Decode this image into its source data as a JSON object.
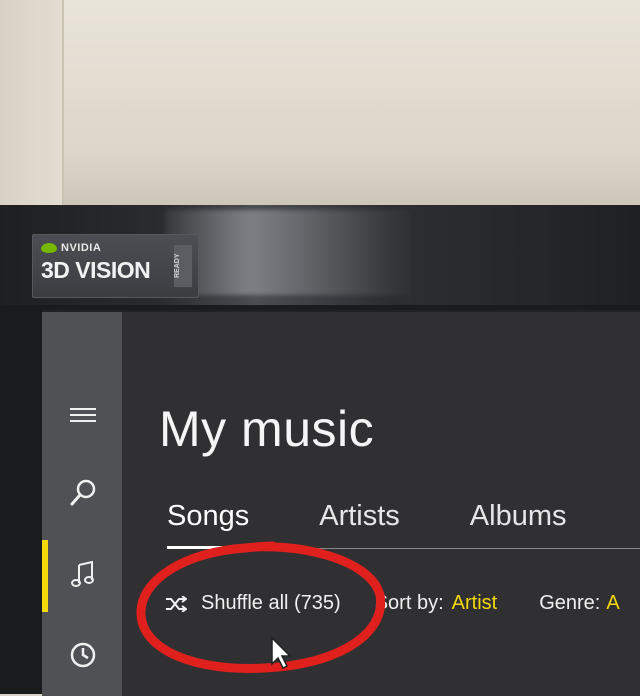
{
  "sticker": {
    "brand": "NVIDIA",
    "product": "3D VISION",
    "tag": "READY"
  },
  "sidebar": {
    "items": [
      {
        "name": "menu",
        "icon": "hamburger-icon"
      },
      {
        "name": "search",
        "icon": "search-icon"
      },
      {
        "name": "music",
        "icon": "music-note-icon",
        "active": true
      },
      {
        "name": "recent",
        "icon": "clock-icon"
      }
    ]
  },
  "main": {
    "title": "My music",
    "tabs": [
      {
        "label": "Songs",
        "active": true
      },
      {
        "label": "Artists",
        "active": false
      },
      {
        "label": "Albums",
        "active": false
      }
    ],
    "toolbar": {
      "shuffle_label": "Shuffle all (735)",
      "sort_label": "Sort by:",
      "sort_value": "Artist",
      "genre_label": "Genre:",
      "genre_value": "A"
    }
  },
  "colors": {
    "accent": "#f5d90a",
    "annotation": "#e0201c",
    "sidebar": "#505154",
    "background": "#303032"
  }
}
